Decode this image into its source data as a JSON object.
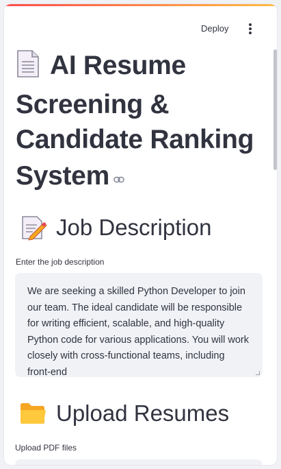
{
  "header": {
    "deploy_label": "Deploy",
    "menu_icon": "kebab-menu-icon"
  },
  "page": {
    "title": "AI Resume Screening & Candidate Ranking System",
    "title_icon": "document-icon",
    "link_icon": "link-icon"
  },
  "job_section": {
    "heading": "Job Description",
    "heading_icon": "memo-pencil-icon",
    "input_label": "Enter the job description",
    "input_value": "We are seeking a skilled Python Developer to join our team. The ideal candidate will be responsible for writing efficient, scalable, and high-quality Python code for various applications. You will work closely with cross-functional teams, including front-end"
  },
  "upload_section": {
    "heading": "Upload Resumes",
    "heading_icon": "folder-icon",
    "input_label": "Upload PDF files"
  },
  "colors": {
    "accent_start": "#ff4b4b",
    "accent_end": "#ffbd45",
    "text": "#31333f",
    "input_bg": "#f0f2f6"
  }
}
